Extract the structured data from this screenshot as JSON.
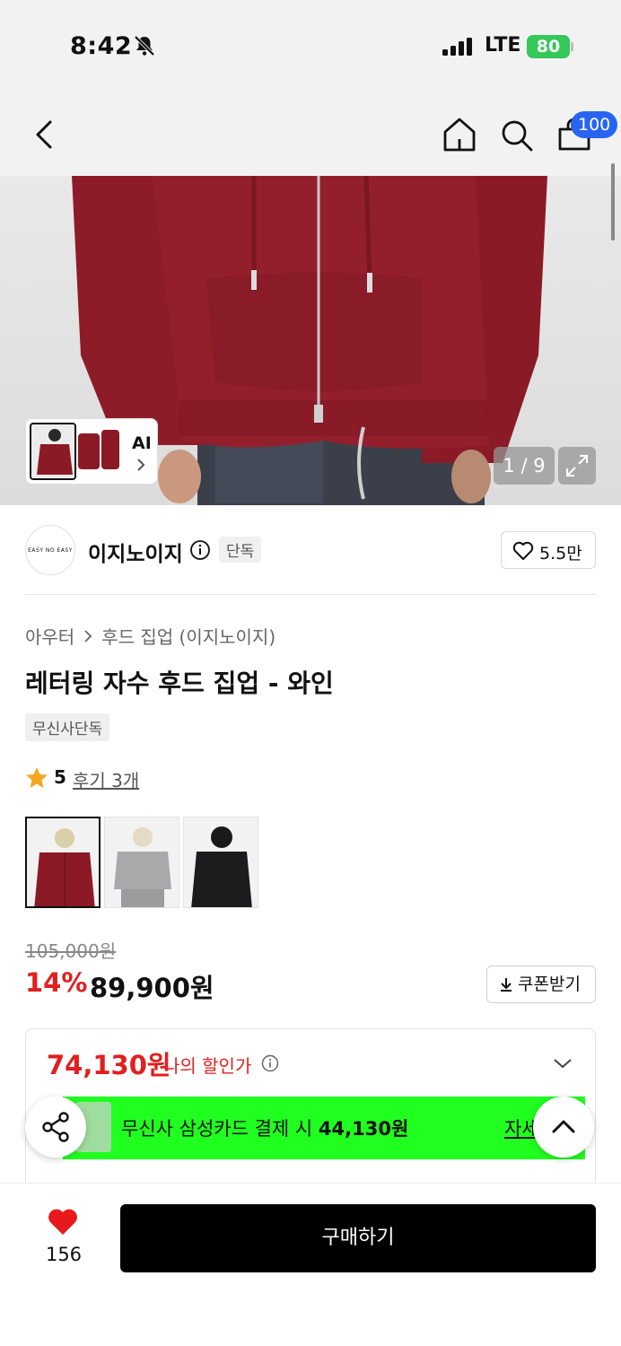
{
  "status_bar": {
    "time": "8:42",
    "network": "LTE",
    "battery": "80"
  },
  "nav": {
    "cart_count": "100"
  },
  "gallery": {
    "ai_label": "AI",
    "counter": "1 / 9"
  },
  "brand": {
    "logo_text": "EASY NO EASY",
    "name": "이지노이지",
    "tag": "단독",
    "likes": "5.5만"
  },
  "product": {
    "breadcrumb": [
      "아우터",
      "후드 집업 (이지노이지)"
    ],
    "title": "레터링 자수 후드 집업 - 와인",
    "badge": "무신사단독",
    "rating": "5",
    "reviews": "후기 3개",
    "swatches": [
      {
        "color": "wine",
        "hex": "#8b1a26"
      },
      {
        "color": "gray",
        "hex": "#a9a9ab"
      },
      {
        "color": "black",
        "hex": "#1c1c1e"
      }
    ]
  },
  "price": {
    "original": "105,000원",
    "discount_rate": "14%",
    "current": "89,900원",
    "coupon_label": "쿠폰받기"
  },
  "my_discount": {
    "price": "74,130원",
    "label": "나의 할인가"
  },
  "promo": {
    "text_prefix": "무신사 삼성카드 결제 시 ",
    "amount": "44,130원",
    "link": "자세히"
  },
  "bottom": {
    "heart_count": "156",
    "buy_label": "구매하기"
  },
  "colors": {
    "accent_red": "#e0201f",
    "promo_green": "#20ff20",
    "badge_blue": "#2864f0",
    "hoodie_wine": "#8b1a26"
  }
}
